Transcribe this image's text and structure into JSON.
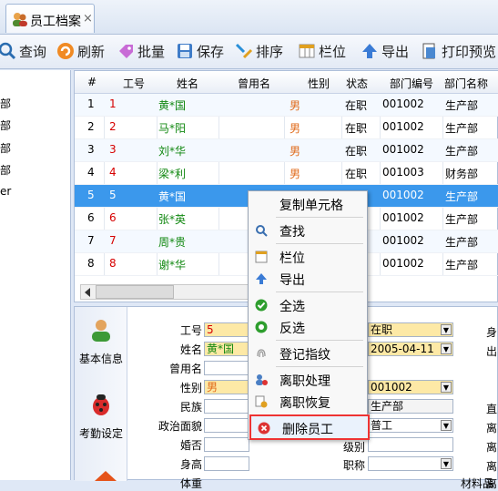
{
  "tab": {
    "title": "员工档案",
    "close": "×"
  },
  "toolbar": [
    "查询",
    "刷新",
    "批量",
    "保存",
    "排序",
    "栏位",
    "导出",
    "打印预览"
  ],
  "leftnav": [
    "部",
    "部",
    "部",
    "部",
    "er"
  ],
  "grid": {
    "columns": [
      "#",
      "工号",
      "姓名",
      "曾用名",
      "性别",
      "状态",
      "部门编号",
      "部门名称"
    ],
    "rows": [
      {
        "n": "1",
        "id": "1",
        "name": "黄*国",
        "alias": "",
        "sex": "男",
        "status": "在职",
        "dept": "001002",
        "dname": "生产部"
      },
      {
        "n": "2",
        "id": "2",
        "name": "马*阳",
        "alias": "",
        "sex": "男",
        "status": "在职",
        "dept": "001002",
        "dname": "生产部"
      },
      {
        "n": "3",
        "id": "3",
        "name": "刘*华",
        "alias": "",
        "sex": "男",
        "status": "在职",
        "dept": "001002",
        "dname": "生产部"
      },
      {
        "n": "4",
        "id": "4",
        "name": "梁*利",
        "alias": "",
        "sex": "男",
        "status": "在职",
        "dept": "001003",
        "dname": "财务部"
      },
      {
        "n": "5",
        "id": "5",
        "name": "黄*国",
        "alias": "",
        "sex": "",
        "status": "在职",
        "dept": "001002",
        "dname": "生产部"
      },
      {
        "n": "6",
        "id": "6",
        "name": "张*英",
        "alias": "",
        "sex": "",
        "status": "",
        "dept": "001002",
        "dname": "生产部"
      },
      {
        "n": "7",
        "id": "7",
        "name": "周*贵",
        "alias": "",
        "sex": "",
        "status": "",
        "dept": "001002",
        "dname": "生产部"
      },
      {
        "n": "8",
        "id": "8",
        "name": "谢*华",
        "alias": "",
        "sex": "",
        "status": "",
        "dept": "001002",
        "dname": "生产部"
      }
    ]
  },
  "side": {
    "basic": "基本信息",
    "attend": "考勤设定"
  },
  "form": {
    "labels": [
      "工号",
      "姓名",
      "曾用名",
      "性别",
      "民族",
      "政治面貌",
      "婚否",
      "身高",
      "体重"
    ],
    "id": "5",
    "name": "黄*国",
    "sex": "男",
    "status": "在职",
    "date": "2005-04-11",
    "dept": "001002",
    "dname": "生产部",
    "worker": "普工",
    "mid_labels": [
      "级别",
      "职称"
    ],
    "right_labels": [
      "身",
      "出",
      "直",
      "离",
      "离",
      "离",
      "离",
      "材料品"
    ]
  },
  "menu": [
    "复制单元格",
    "查找",
    "栏位",
    "导出",
    "全选",
    "反选",
    "登记指纹",
    "离职处理",
    "离职恢复",
    "删除员工"
  ]
}
